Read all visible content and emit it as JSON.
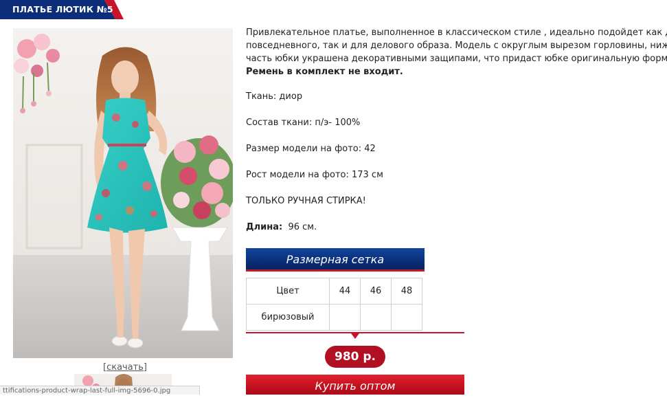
{
  "product": {
    "title": "ПЛАТЬЕ ЛЮТИК №5",
    "download_link": "[скачать]"
  },
  "description": {
    "line1": "Привлекательное платье, выполненное в классическом стиле , идеально подойдет как дл",
    "line2": "повседневного, так и для делового образа. Модель с округлым вырезом горловины, ниж",
    "line3": "часть юбки украшена декоративными защипами, что придаст юбке оригинальную форму",
    "belt_note": "Ремень в комплект не входит."
  },
  "properties": {
    "fabric": "Ткань: диор",
    "composition": "Состав ткани: п/э- 100%",
    "model_size": "Размер модели на фото: 42",
    "model_height": "Рост модели на фото: 173 см",
    "care": "ТОЛЬКО РУЧНАЯ СТИРКА!",
    "length_label": "Длина:",
    "length_value": "96 см."
  },
  "size_chart": {
    "title": "Размерная сетка",
    "color_header": "Цвет",
    "sizes": [
      "44",
      "46",
      "48"
    ],
    "row_color": "бирюзовый"
  },
  "price": "980 р.",
  "buy_button": "Купить оптом",
  "status_bar": "ttifications-product-wrap-last-full-img-5696-0.jpg",
  "colors": {
    "brand_blue": "#0a2f78",
    "brand_red": "#c8142a",
    "price_red": "#b30f22"
  }
}
